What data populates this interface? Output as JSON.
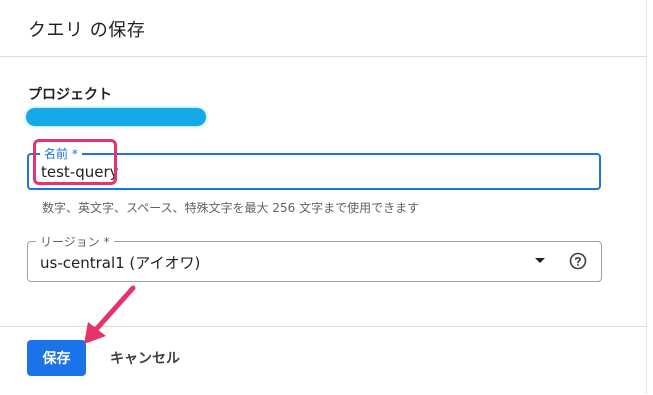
{
  "dialog": {
    "title": "クエリ の保存"
  },
  "project": {
    "label": "プロジェクト"
  },
  "name_field": {
    "label": "名前 *",
    "value": "test-query",
    "hint": "数字、英文字、スペース、特殊文字を最大 256 文字まで使用できます"
  },
  "region_field": {
    "label": "リージョン *",
    "value": "us-central1 (アイオワ)",
    "help_icon": "help-circle-icon",
    "dropdown_icon": "dropdown-arrow-icon"
  },
  "footer": {
    "save_label": "保存",
    "cancel_label": "キャンセル"
  },
  "annotations": {
    "highlight_color": "#e8336a",
    "redaction_color": "#14a9e8"
  },
  "colors": {
    "accent": "#1a73e8",
    "text": "#202124",
    "muted": "#5f6368"
  }
}
